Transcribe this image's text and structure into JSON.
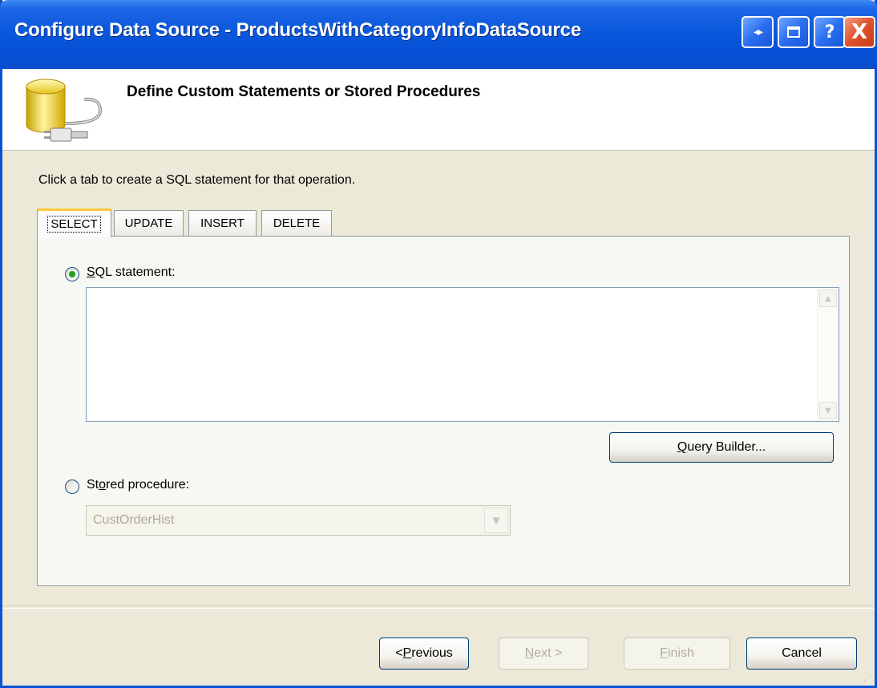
{
  "window": {
    "title": "Configure Data Source - ProductsWithCategoryInfoDataSource",
    "controls": {
      "restore": "⟳",
      "maximize": "❐",
      "help": "?",
      "close": "X"
    }
  },
  "header": {
    "title": "Define Custom Statements or Stored Procedures",
    "icon": "database-plug-icon"
  },
  "instructions": "Click a tab to create a SQL statement for that operation.",
  "tabs": [
    {
      "label": "SELECT",
      "active": true
    },
    {
      "label": "UPDATE",
      "active": false
    },
    {
      "label": "INSERT",
      "active": false
    },
    {
      "label": "DELETE",
      "active": false
    }
  ],
  "sql_statement": {
    "label_prefix": "",
    "label_hotkey": "S",
    "label_rest": "QL statement:",
    "selected": true,
    "value": ""
  },
  "query_builder": {
    "hotkey": "Q",
    "rest": "uery Builder..."
  },
  "stored_procedure": {
    "label_prefix": "St",
    "label_hotkey": "o",
    "label_rest": "red procedure:",
    "selected": false,
    "value": "CustOrderHist"
  },
  "buttons": {
    "previous": {
      "prefix": "< ",
      "hotkey": "P",
      "rest": "revious"
    },
    "next": {
      "hotkey": "N",
      "rest": "ext >"
    },
    "finish": {
      "hotkey": "F",
      "rest": "inish"
    },
    "cancel": "Cancel"
  },
  "colors": {
    "title_bar": "#0a58dc",
    "dialog_bg": "#ece9d8",
    "radio_dot": "#21a121",
    "active_tab_accent": "#ffc83c"
  }
}
